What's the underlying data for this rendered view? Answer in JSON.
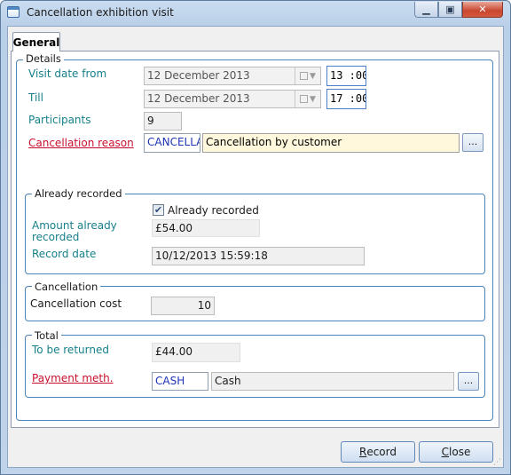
{
  "window": {
    "title": "Cancellation exhibition visit",
    "controls": {
      "minimize": "▁",
      "maximize": "▣",
      "close": "✕"
    }
  },
  "tabs": [
    {
      "label": "General",
      "selected": true
    }
  ],
  "details": {
    "legend": "Details",
    "visit_date_from": {
      "label": "Visit date from",
      "date": "12 December 2013",
      "time": "13 :00"
    },
    "till": {
      "label": "Till",
      "date": "12 December 2013",
      "time": "17 :00"
    },
    "participants": {
      "label": "Participants",
      "value": "9"
    },
    "cancellation_reason": {
      "label": "Cancellation reason",
      "code": "CANCELLA",
      "description": "Cancellation by customer",
      "lookup_label": "..."
    }
  },
  "already_recorded": {
    "legend": "Already recorded",
    "checkbox_label": "Already recorded",
    "checked": true,
    "amount_label_line1": "Amount already",
    "amount_label_line2": "recorded",
    "amount_value": "£54.00",
    "record_date_label": "Record date",
    "record_date_value": "10/12/2013 15:59:18"
  },
  "cancellation": {
    "legend": "Cancellation",
    "cost_label": "Cancellation cost",
    "cost_value": "10"
  },
  "total": {
    "legend": "Total",
    "to_be_returned_label": "To be returned",
    "to_be_returned_value": "£44.00",
    "payment_method_label": "Payment meth.",
    "payment_code": "CASH",
    "payment_description": "Cash",
    "lookup_label": "..."
  },
  "buttons": {
    "record_first": "R",
    "record_rest": "ecord",
    "close_first": "C",
    "close_rest": "lose"
  },
  "colors": {
    "label_teal": "#16808a",
    "label_red": "#c8102e",
    "code_blue": "#1f35b5",
    "group_border": "#4a84b8"
  },
  "icons": {
    "window": "window-icon",
    "calendar": "calendar-icon",
    "dropdown": "chevron-down-icon",
    "checkbox": "checkmark-icon",
    "resize": "resize-grip-icon"
  }
}
